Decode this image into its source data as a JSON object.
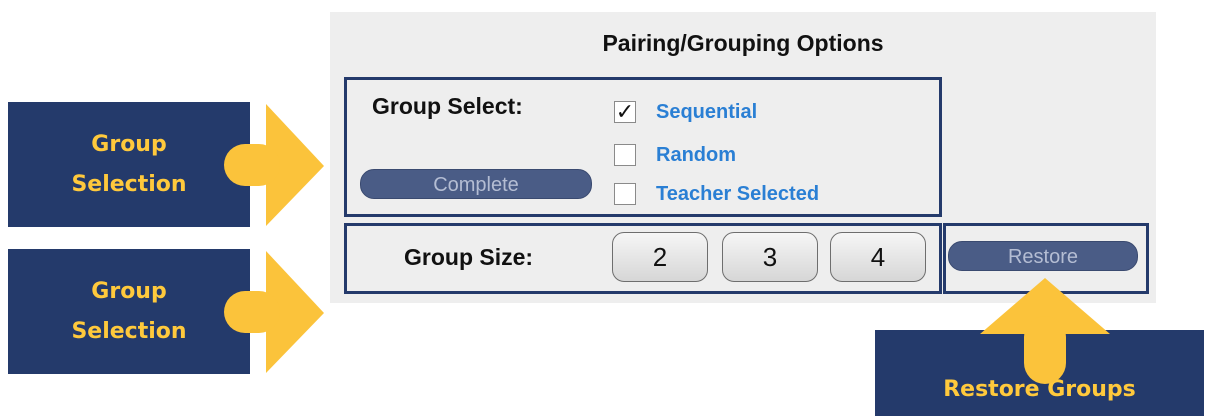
{
  "panel": {
    "title": "Pairing/Grouping Options",
    "group_select": {
      "label": "Group Select:",
      "complete_button": "Complete",
      "options": [
        {
          "label": "Sequential",
          "checked": true
        },
        {
          "label": "Random",
          "checked": false
        },
        {
          "label": "Teacher Selected",
          "checked": false
        }
      ]
    },
    "group_size": {
      "label": "Group Size:",
      "buttons": [
        "2",
        "3",
        "4"
      ]
    },
    "restore_button": "Restore"
  },
  "callouts": {
    "first": "Group Selection",
    "second": "Group Selection",
    "restore": "Restore Groups"
  },
  "colors": {
    "callout_bg": "#243a6b",
    "callout_text": "#ffc93c",
    "arrow": "#fbc33b",
    "option_text": "#2a7fd4",
    "panel_bg": "#eeeeee"
  }
}
